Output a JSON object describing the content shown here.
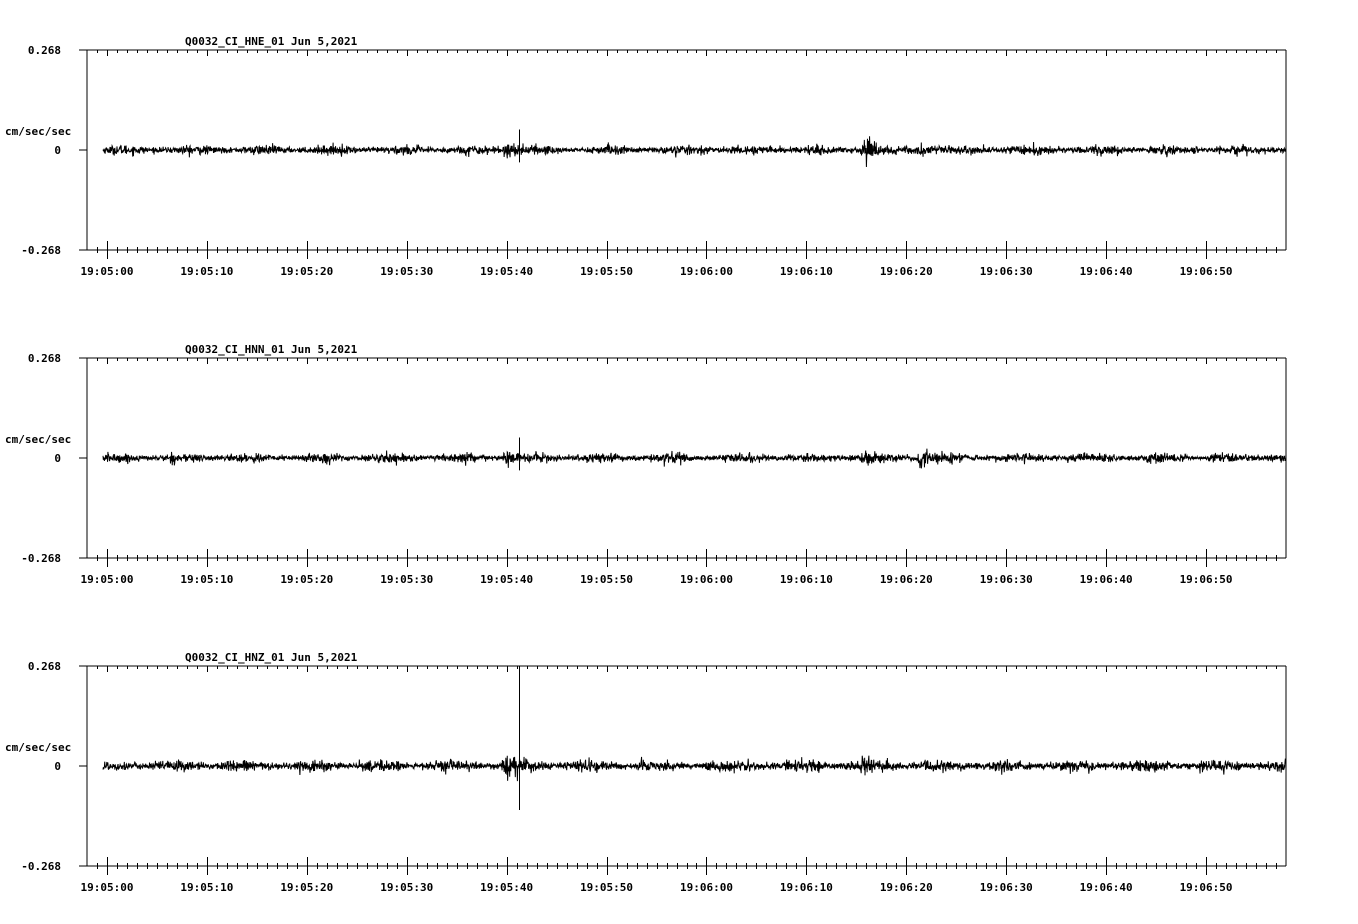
{
  "chart_data": [
    {
      "type": "line",
      "title": "Q0032_CI_HNE_01  Jun 5,2021",
      "ylabel": "cm/sec/sec",
      "ylim": [
        -0.268,
        0.268
      ],
      "y_tick_labels": [
        "0.268",
        "0",
        "-0.268"
      ],
      "x_tick_labels": [
        "19:05:00",
        "19:05:10",
        "19:05:20",
        "19:05:30",
        "19:05:40",
        "19:05:50",
        "19:06:00",
        "19:06:10",
        "19:06:20",
        "19:06:30",
        "19:06:40",
        "19:06:50"
      ],
      "xlim_seconds": [
        -2,
        118
      ],
      "noise_amplitude": 0.012,
      "events": [
        {
          "t": 40.0,
          "peak": 0.045,
          "duration": 4
        },
        {
          "t": 41.2,
          "spike": 0.055
        },
        {
          "t": 75.8,
          "peak": 0.07,
          "duration": 6
        },
        {
          "t": 81.5,
          "peak": 0.03,
          "duration": 4
        }
      ]
    },
    {
      "type": "line",
      "title": "Q0032_CI_HNN_01  Jun 5,2021",
      "ylabel": "cm/sec/sec",
      "ylim": [
        -0.268,
        0.268
      ],
      "y_tick_labels": [
        "0.268",
        "0",
        "-0.268"
      ],
      "x_tick_labels": [
        "19:05:00",
        "19:05:10",
        "19:05:20",
        "19:05:30",
        "19:05:40",
        "19:05:50",
        "19:06:00",
        "19:06:10",
        "19:06:20",
        "19:06:30",
        "19:06:40",
        "19:06:50"
      ],
      "xlim_seconds": [
        -2,
        118
      ],
      "noise_amplitude": 0.012,
      "events": [
        {
          "t": 40.0,
          "peak": 0.03,
          "duration": 4
        },
        {
          "t": 41.2,
          "spike": 0.055
        },
        {
          "t": 75.8,
          "peak": 0.04,
          "duration": 6
        },
        {
          "t": 81.5,
          "peak": 0.04,
          "duration": 3
        }
      ]
    },
    {
      "type": "line",
      "title": "Q0032_CI_HNZ_01  Jun 5,2021",
      "ylabel": "cm/sec/sec",
      "ylim": [
        -0.268,
        0.268
      ],
      "y_tick_labels": [
        "0.268",
        "0",
        "-0.268"
      ],
      "x_tick_labels": [
        "19:05:00",
        "19:05:10",
        "19:05:20",
        "19:05:30",
        "19:05:40",
        "19:05:50",
        "19:06:00",
        "19:06:10",
        "19:06:20",
        "19:06:30",
        "19:06:40",
        "19:06:50"
      ],
      "xlim_seconds": [
        -2,
        118
      ],
      "noise_amplitude": 0.015,
      "events": [
        {
          "t": 40.0,
          "peak": 0.05,
          "duration": 4
        },
        {
          "t": 41.2,
          "spike_up": 0.268,
          "spike_down": -0.118
        },
        {
          "t": 75.8,
          "peak": 0.04,
          "duration": 5
        }
      ]
    }
  ]
}
